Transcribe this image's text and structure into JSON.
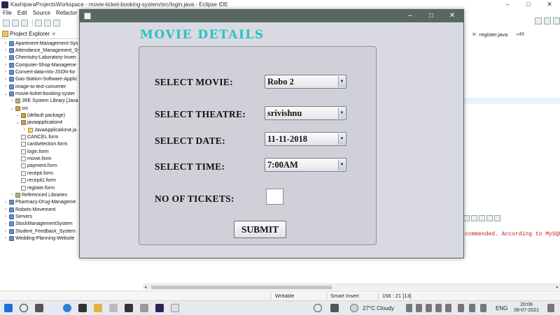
{
  "eclipse": {
    "title": "KashiparaProjectsWorkspace - movie-ticket-booking-system/src/login.java - Eclipse IDE",
    "menu": [
      "File",
      "Edit",
      "Source",
      "Refactor",
      "N"
    ],
    "window_controls": {
      "minimize": "–",
      "maximize": "□",
      "close": "✕"
    }
  },
  "project_explorer": {
    "title": "Project Explorer",
    "close_glyph": "✕",
    "items": [
      {
        "label": "Apartment-Management-Sys",
        "twisty": "›",
        "icon": "project",
        "indent": 0
      },
      {
        "label": "Attendance_Management_Sy",
        "twisty": "›",
        "icon": "project",
        "indent": 0
      },
      {
        "label": "Chemistry-Laboratory-Inven",
        "twisty": "›",
        "icon": "project",
        "indent": 0
      },
      {
        "label": "Computer-Shop-Manageme",
        "twisty": "›",
        "icon": "project",
        "indent": 0
      },
      {
        "label": "Convert-data-into-JSON-for",
        "twisty": "›",
        "icon": "project",
        "indent": 0
      },
      {
        "label": "Gas-Station-Software-Applic",
        "twisty": "›",
        "icon": "project",
        "indent": 0
      },
      {
        "label": "image-to-text-converter",
        "twisty": "›",
        "icon": "project",
        "indent": 0
      },
      {
        "label": "movie-ticket-booking-syster",
        "twisty": "⌄",
        "icon": "project",
        "indent": 0
      },
      {
        "label": "JRE System Library [JavaSE",
        "twisty": "›",
        "icon": "library",
        "indent": 1
      },
      {
        "label": "src",
        "twisty": "⌄",
        "icon": "package",
        "indent": 1
      },
      {
        "label": "(default package)",
        "twisty": "›",
        "icon": "package",
        "indent": 2
      },
      {
        "label": "javaapplication4",
        "twisty": "⌄",
        "icon": "package",
        "indent": 2
      },
      {
        "label": "JavaApplication4.ja",
        "twisty": "›",
        "icon": "java",
        "indent": 3
      },
      {
        "label": "CANCEL.form",
        "twisty": "",
        "icon": "file",
        "indent": 2
      },
      {
        "label": "cardselection.form",
        "twisty": "",
        "icon": "file",
        "indent": 2
      },
      {
        "label": "login.form",
        "twisty": "",
        "icon": "file",
        "indent": 2
      },
      {
        "label": "movie.form",
        "twisty": "",
        "icon": "file",
        "indent": 2
      },
      {
        "label": "payment.form",
        "twisty": "",
        "icon": "file",
        "indent": 2
      },
      {
        "label": "recepit.form",
        "twisty": "",
        "icon": "file",
        "indent": 2
      },
      {
        "label": "recepit1.form",
        "twisty": "",
        "icon": "file",
        "indent": 2
      },
      {
        "label": "register.form",
        "twisty": "",
        "icon": "file",
        "indent": 2
      },
      {
        "label": "Referenced Libraries",
        "twisty": "›",
        "icon": "library",
        "indent": 1
      },
      {
        "label": "Pharmacy-Drug-Manageme",
        "twisty": "›",
        "icon": "project",
        "indent": 0
      },
      {
        "label": "Robots-Movement",
        "twisty": "›",
        "icon": "project",
        "indent": 0
      },
      {
        "label": "Servers",
        "twisty": "›",
        "icon": "project",
        "indent": 0
      },
      {
        "label": "StockManagementSystem",
        "twisty": "›",
        "icon": "project",
        "indent": 0
      },
      {
        "label": "Student_Feedback_System",
        "twisty": "›",
        "icon": "project",
        "indent": 0
      },
      {
        "label": "Wedding-Planning-Website",
        "twisty": "›",
        "icon": "project",
        "indent": 0
      }
    ]
  },
  "editor": {
    "tab_close": "✕",
    "tab_label": "register.java",
    "tab_overflow": "»48",
    "console_text": "commended. According to MySQL 5"
  },
  "statusbar": {
    "mode": "Writable",
    "insert": "Smart Insert",
    "position": "156 : 21 [13]"
  },
  "taskbar": {
    "weather": "27°C  Cloudy",
    "lang": "ENG",
    "time": "20:06",
    "date": "06-07-2021"
  },
  "dialog": {
    "window_controls": {
      "minimize": "–",
      "maximize": "□",
      "close": "✕"
    },
    "heading": "MOVIE DETAILS",
    "labels": {
      "movie": "SELECT MOVIE:",
      "theatre": "SELECT  THEATRE:",
      "date": "SELECT DATE:",
      "time": "SELECT TIME:",
      "tickets": "NO OF TICKETS:"
    },
    "selects": {
      "movie": "Robo 2",
      "theatre": "srivishnu",
      "date": "11-11-2018",
      "time": "7:00AM"
    },
    "combo_arrow": "▼",
    "tickets_value": "",
    "submit_label": "SUBMIT"
  },
  "colors": {
    "dialog_title_bar": "#576762",
    "heading": "#2ac1c7",
    "dialog_bg": "#d8d9e1",
    "console_error": "#c02020"
  }
}
